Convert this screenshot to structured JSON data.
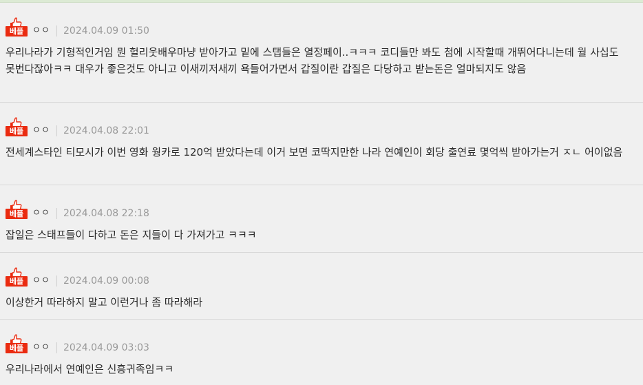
{
  "comments": [
    {
      "badge": "베플",
      "author": "ㅇㅇ",
      "date": "2024.04.09 01:50",
      "text": "우리나라가 기형적인거임 뭔 헐리웃배우마냥 받아가고 밑에 스탭들은 열정페이..ㅋㅋㅋ 코디들만 봐도 첨에 시작할때 개뛰어다니는데 월 사십도 못번다잖아ㅋㅋ 대우가 좋은것도 아니고 이새끼저새끼 욕들어가면서 갑질이란 갑질은 다당하고 받는돈은 얼마되지도 않음"
    },
    {
      "badge": "베플",
      "author": "ㅇㅇ",
      "date": "2024.04.08 22:01",
      "text": "전세계스타인 티모시가 이번 영화 웡카로 120억 받았다는데 이거 보면 코딱지만한 나라 연예인이 회당 출연료 몇억씩 받아가는거 ㅈㄴ 어이없음"
    },
    {
      "badge": "베플",
      "author": "ㅇㅇ",
      "date": "2024.04.08 22:18",
      "text": "잡일은 스태프들이 다하고 돈은 지들이 다 가져가고 ㅋㅋㅋ"
    },
    {
      "badge": "베플",
      "author": "ㅇㅇ",
      "date": "2024.04.09 00:08",
      "text": "이상한거 따라하지 말고 이런거나 좀 따라해라"
    },
    {
      "badge": "베플",
      "author": "ㅇㅇ",
      "date": "2024.04.09 03:03",
      "text": "우리나라에서 연예인은 신흥귀족임ㅋㅋ"
    }
  ]
}
